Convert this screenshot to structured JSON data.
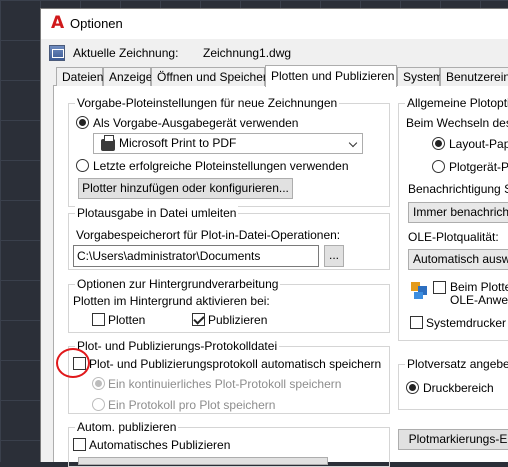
{
  "window": {
    "title": "Optionen"
  },
  "drawing": {
    "label": "Aktuelle Zeichnung:",
    "name": "Zeichnung1.dwg"
  },
  "tabs": [
    {
      "label": "Dateien"
    },
    {
      "label": "Anzeige"
    },
    {
      "label": "Öffnen und Speichern"
    },
    {
      "label": "Plotten und Publizieren"
    },
    {
      "label": "System"
    },
    {
      "label": "Benutzereinstell"
    }
  ],
  "defaults": {
    "legend": "Vorgabe-Ploteinstellungen für neue Zeichnungen",
    "radio_default_device": "Als Vorgabe-Ausgabegerät verwenden",
    "device_value": "Microsoft Print to PDF",
    "radio_last_settings": "Letzte erfolgreiche Ploteinstellungen verwenden",
    "add_plotter_button": "Plotter hinzufügen oder konfigurieren..."
  },
  "plot_to_file": {
    "legend": "Plotausgabe in Datei umleiten",
    "location_label": "Vorgabespeicherort für Plot-in-Datei-Operationen:",
    "path_value": "C:\\Users\\administrator\\Documents",
    "browse_button": "..."
  },
  "background": {
    "legend": "Optionen zur Hintergrundverarbeitung",
    "enable_label": "Plotten im Hintergrund aktivieren bei:",
    "plot_label": "Plotten",
    "publish_label": "Publizieren"
  },
  "log": {
    "legend": "Plot- und Publizierungs-Protokolldatei",
    "auto_save_label": "Plot- und Publizierungsprotokoll automatisch speichern",
    "continuous_label": "Ein kontinuierliches Plot-Protokoll speichern",
    "per_plot_label": "Ein Protokoll pro Plot speichern"
  },
  "auto_publish": {
    "legend": "Autom. publizieren",
    "checkbox_label": "Automatisches Publizieren"
  },
  "general": {
    "legend": "Allgemeine Plotoption",
    "on_change_label": "Beim Wechseln des P",
    "radio_layout": "Layout-Papie",
    "radio_device": "Plotgerät-Pap",
    "notify_label": "Benachrichtigung Sys",
    "notify_value": "Immer benachrichtig",
    "ole_label": "OLE-Plotqualität:",
    "ole_value": "Automatisch auswäh",
    "beim_plotten_label": "Beim Plotten",
    "ole_apps_label": "OLE-Anwend",
    "system_printer_label": "Systemdrucker au"
  },
  "offset": {
    "legend": "Plotversatz angeben r",
    "radio_print_area": "Druckbereich"
  },
  "stamp_button": "Plotmarkierungs-E"
}
